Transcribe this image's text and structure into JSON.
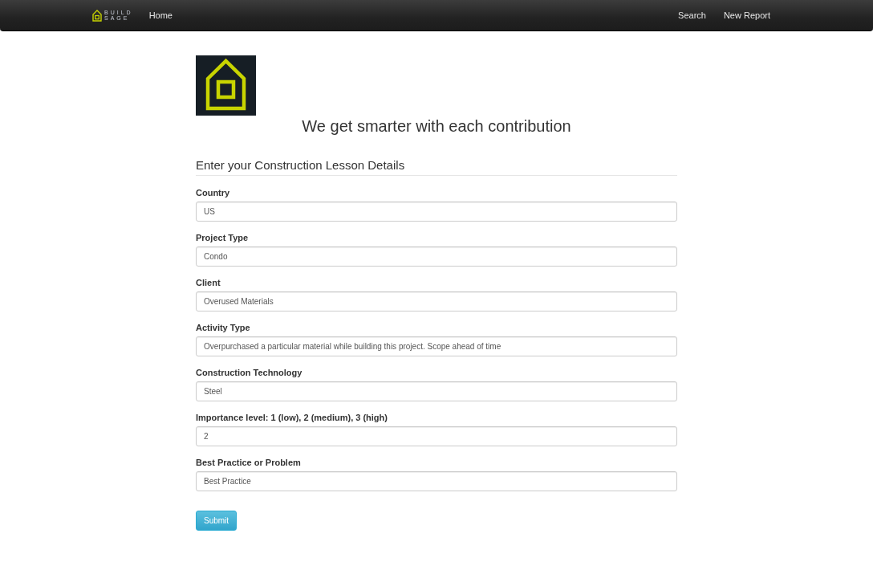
{
  "navbar": {
    "brand": [
      "BUILD",
      "SAGE"
    ],
    "left_links": [
      "Home"
    ],
    "right_links": [
      "Search",
      "New Report"
    ]
  },
  "heading": "We get smarter with each contribution",
  "form": {
    "legend": "Enter your Construction Lesson Details",
    "fields": [
      {
        "label": "Country",
        "value": "US"
      },
      {
        "label": "Project Type",
        "value": "Condo"
      },
      {
        "label": "Client",
        "value": "Overused Materials"
      },
      {
        "label": "Activity Type",
        "value": "Overpurchased a particular material while building this project. Scope ahead of time"
      },
      {
        "label": "Construction Technology",
        "value": "Steel"
      },
      {
        "label": "Importance level: 1 (low), 2 (medium), 3 (high)",
        "value": "2"
      },
      {
        "label": "Best Practice or Problem",
        "value": "Best Practice"
      }
    ],
    "submit": "Submit"
  }
}
